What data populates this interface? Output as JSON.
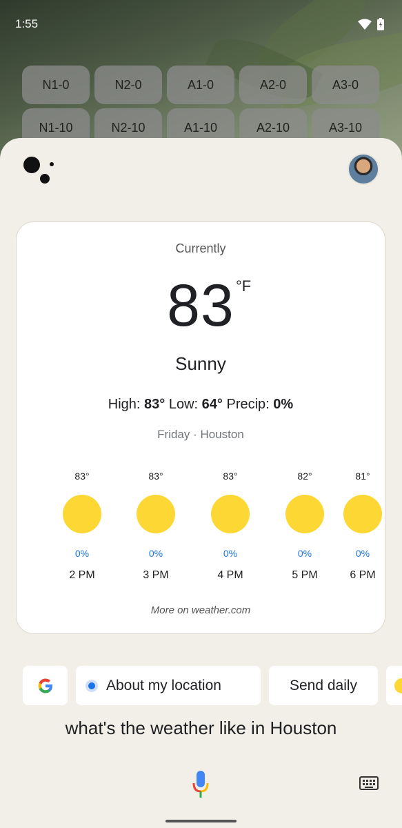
{
  "status_bar": {
    "time": "1:55"
  },
  "app_grid": [
    [
      "N1-0",
      "N2-0",
      "A1-0",
      "A2-0",
      "A3-0"
    ],
    [
      "N1-10",
      "N2-10",
      "A1-10",
      "A2-10",
      "A3-10"
    ]
  ],
  "weather": {
    "currently_label": "Currently",
    "temperature": "83",
    "unit": "°F",
    "condition": "Sunny",
    "high_label": "High:",
    "high": "83°",
    "low_label": "Low:",
    "low": "64°",
    "precip_label": "Precip:",
    "precip": "0%",
    "day_location": "Friday · Houston",
    "hourly": [
      {
        "temp": "83°",
        "precip": "0%",
        "time": "2 PM",
        "icon": "sun-icon"
      },
      {
        "temp": "83°",
        "precip": "0%",
        "time": "3 PM",
        "icon": "sun-icon"
      },
      {
        "temp": "83°",
        "precip": "0%",
        "time": "4 PM",
        "icon": "sun-icon"
      },
      {
        "temp": "82°",
        "precip": "0%",
        "time": "5 PM",
        "icon": "sun-icon"
      },
      {
        "temp": "81°",
        "precip": "0%",
        "time": "6 PM",
        "icon": "sun-icon"
      }
    ],
    "more_link": "More on weather.com"
  },
  "chips": {
    "about_location": "About my location",
    "send_daily": "Send daily"
  },
  "query": "what's the weather like in Houston",
  "colors": {
    "sheet_bg": "#f2efe8",
    "sun": "#fdd835",
    "precip_blue": "#1a73e8"
  }
}
